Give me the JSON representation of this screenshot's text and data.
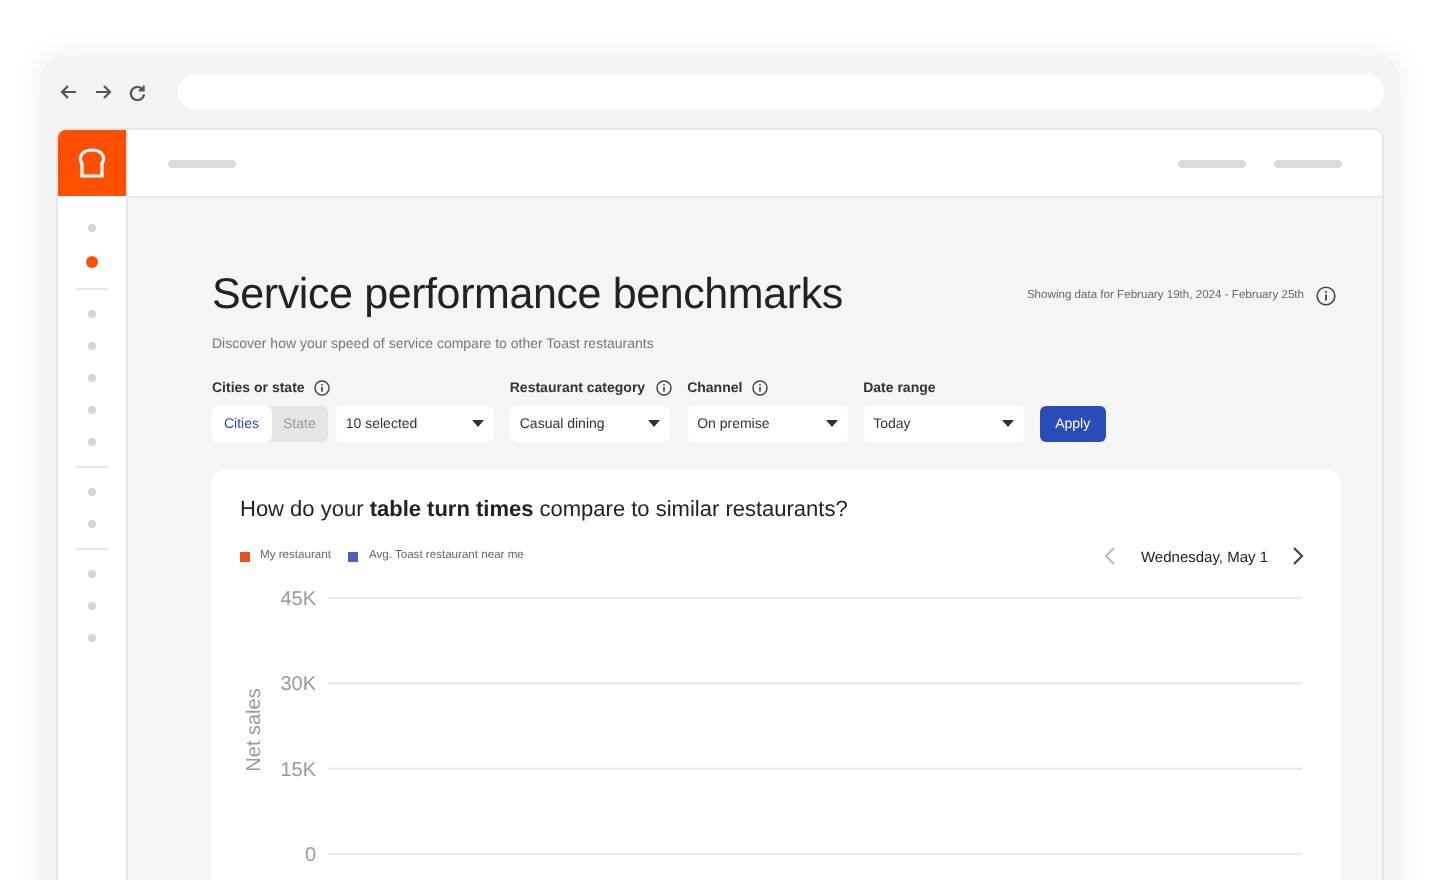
{
  "sidebar": {
    "groups": [
      {
        "items": [
          {
            "selected": false
          },
          {
            "selected": true
          }
        ]
      },
      {
        "items": [
          {
            "selected": false
          },
          {
            "selected": false
          },
          {
            "selected": false
          },
          {
            "selected": false
          },
          {
            "selected": false
          }
        ]
      },
      {
        "items": [
          {
            "selected": false
          },
          {
            "selected": false
          }
        ]
      },
      {
        "items": [
          {
            "selected": false
          },
          {
            "selected": false
          },
          {
            "selected": false
          }
        ]
      }
    ]
  },
  "page": {
    "title": "Service performance benchmarks",
    "subtitle": "Discover how your speed of service compare to other Toast restaurants",
    "date_note": "Showing data for February 19th, 2024 - February 25th"
  },
  "filters": [
    {
      "kind": "segmented",
      "label": "Cities or state",
      "info": true,
      "segments": [
        {
          "label": "Cities",
          "selected": true
        },
        {
          "label": "State",
          "selected": false
        }
      ],
      "value": "10 selected"
    },
    {
      "kind": "dropdown",
      "label": "Restaurant category",
      "info": true,
      "value": "Casual dining"
    },
    {
      "kind": "dropdown",
      "label": "Channel",
      "info": true,
      "value": "On premise"
    },
    {
      "kind": "dropdown",
      "label": "Date range",
      "info": false,
      "value": "Today"
    }
  ],
  "apply_button": "Apply",
  "card": {
    "question": "How do your **table turn times** compare to similar restaurants?",
    "date": "Wednesday, May 1",
    "chart_data": {
      "type": "bar",
      "ylabel": "Net sales",
      "ylim": [
        0,
        45000
      ],
      "yticks": [
        {
          "value": 0,
          "label": "0"
        },
        {
          "value": 15000,
          "label": "15K"
        },
        {
          "value": 30000,
          "label": "30K"
        },
        {
          "value": 45000,
          "label": "45K"
        }
      ],
      "series": [
        {
          "name": "My restaurant",
          "color": "#e8531f"
        },
        {
          "name": "Avg. Toast restaurant near me",
          "color": "#4a5fc1"
        }
      ]
    }
  }
}
